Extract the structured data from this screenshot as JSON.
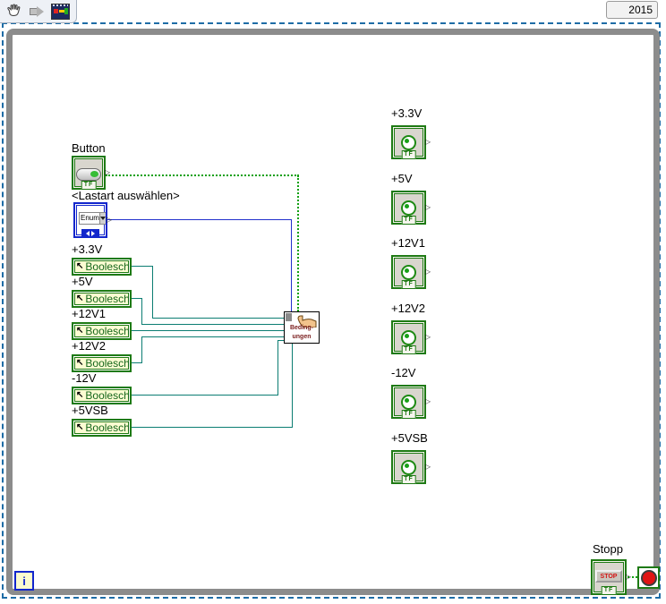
{
  "header": {
    "version_label": "2015"
  },
  "toolbar": {
    "icons": [
      {
        "name": "pan-hand-icon"
      },
      {
        "name": "arrow-tool-icon"
      },
      {
        "name": "vi-film-icon"
      }
    ]
  },
  "loop": {
    "iteration_label": "i"
  },
  "controls": {
    "button": {
      "label": "Button",
      "terminal": "TF"
    },
    "enum": {
      "label": "<Lastart auswählen>",
      "value": "Enum"
    },
    "locals": [
      {
        "label": "+3.3V",
        "name": "Boolesch"
      },
      {
        "label": "+5V",
        "name": "Boolesch"
      },
      {
        "label": "+12V1",
        "name": "Boolesch"
      },
      {
        "label": "+12V2",
        "name": "Boolesch"
      },
      {
        "label": "-12V",
        "name": "Boolesch"
      },
      {
        "label": "+5VSB",
        "name": "Boolesch"
      }
    ],
    "stop": {
      "label": "Stopp",
      "button_text": "STOP",
      "terminal": "TF"
    }
  },
  "subvi": {
    "line1": "Beding-",
    "line2": "ungen"
  },
  "indicators": [
    {
      "label": "+3.3V",
      "terminal": "TF"
    },
    {
      "label": "+5V",
      "terminal": "TF"
    },
    {
      "label": "+12V1",
      "terminal": "TF"
    },
    {
      "label": "+12V2",
      "terminal": "TF"
    },
    {
      "label": "-12V",
      "terminal": "TF"
    },
    {
      "label": "+5VSB",
      "terminal": "TF"
    }
  ],
  "colors": {
    "boolean_green": "#1e7a14",
    "wire_teal": "#0b7d72",
    "wire_blue": "#2230cc",
    "boolean_wire_green": "#12a012",
    "loop_border_gray": "#8c8c8c",
    "selection_blue": "#1e6ca6",
    "stop_red": "#d41414",
    "local_bg": "#fcfcd2"
  }
}
